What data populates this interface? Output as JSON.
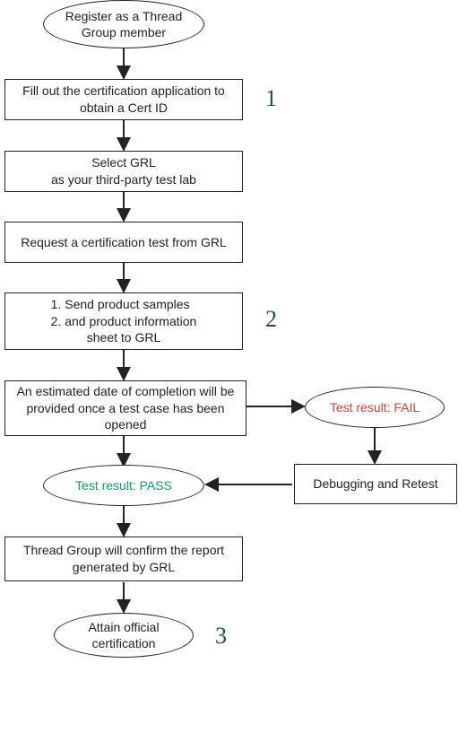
{
  "nodes": {
    "register": "Register as a Thread Group member",
    "fillcert": "Fill out the certification application to obtain a Cert ID",
    "selectgrl": "Select GRL\nas your third-party test lab",
    "request": "Request a certification test from GRL",
    "samples_l1": "1.  Send product samples",
    "samples_l2": "2.  and product information",
    "samples_l3": "sheet to GRL",
    "estimated": "An estimated date of completion will be provided once a test case has been opened",
    "pass": "Test result: PASS",
    "fail": "Test result: FAIL",
    "debug": "Debugging and Retest",
    "confirm": "Thread Group will confirm the report generated by GRL",
    "attain": "Attain official certification"
  },
  "annotations": {
    "one": "1",
    "two": "2",
    "three": "3"
  }
}
